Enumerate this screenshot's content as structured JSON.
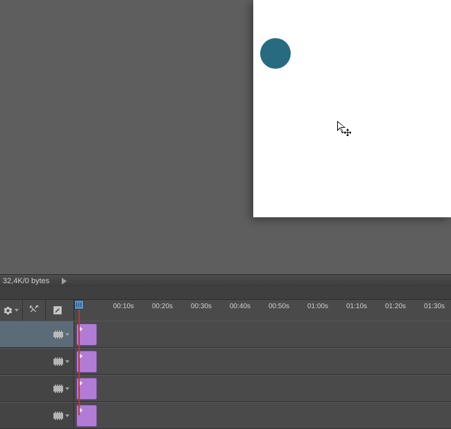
{
  "status": {
    "text": "32,4K/0 bytes"
  },
  "toolbar": {
    "settings_label": "settings",
    "cut_label": "cut",
    "edit_label": "edit"
  },
  "ruler": {
    "interval_s": 10,
    "ticks": [
      "00:10s",
      "00:20s",
      "00:30s",
      "00:40s",
      "00:50s",
      "01:00s",
      "01:10s",
      "01:20s",
      "01:30s"
    ]
  },
  "playhead": {
    "position_s": 0
  },
  "tracks": [
    {
      "id": "track-1",
      "kind": "video",
      "selected": true
    },
    {
      "id": "track-2",
      "kind": "video",
      "selected": false
    },
    {
      "id": "track-3",
      "kind": "video",
      "selected": false
    },
    {
      "id": "track-4",
      "kind": "video",
      "selected": false
    }
  ],
  "colors": {
    "circle": "#286b80",
    "clip": "#b27cd6",
    "playhead": "#b33b3b"
  },
  "canvas": {
    "object": "circle"
  }
}
